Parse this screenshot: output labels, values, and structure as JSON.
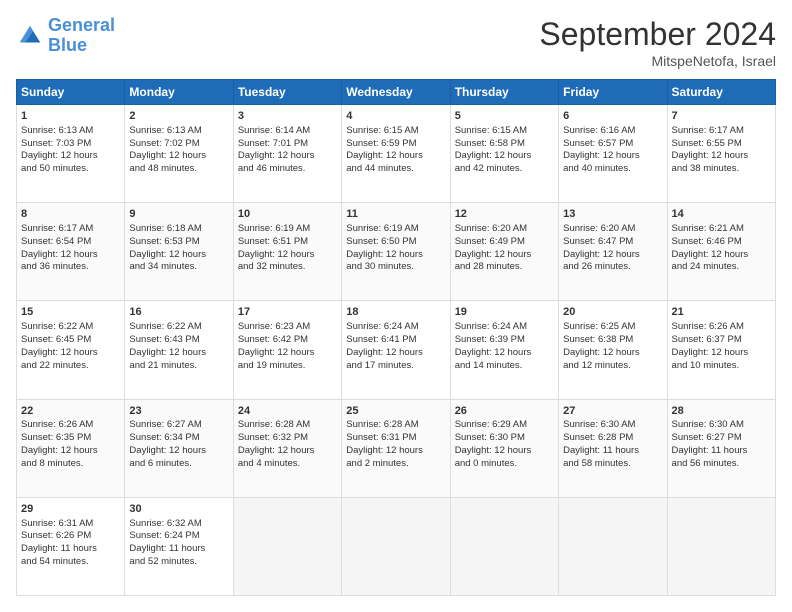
{
  "header": {
    "logo_line1": "General",
    "logo_line2": "Blue",
    "month": "September 2024",
    "location": "MitspeNetofa, Israel"
  },
  "weekdays": [
    "Sunday",
    "Monday",
    "Tuesday",
    "Wednesday",
    "Thursday",
    "Friday",
    "Saturday"
  ],
  "weeks": [
    [
      {
        "day": 1,
        "lines": [
          "Sunrise: 6:13 AM",
          "Sunset: 7:03 PM",
          "Daylight: 12 hours",
          "and 50 minutes."
        ]
      },
      {
        "day": 2,
        "lines": [
          "Sunrise: 6:13 AM",
          "Sunset: 7:02 PM",
          "Daylight: 12 hours",
          "and 48 minutes."
        ]
      },
      {
        "day": 3,
        "lines": [
          "Sunrise: 6:14 AM",
          "Sunset: 7:01 PM",
          "Daylight: 12 hours",
          "and 46 minutes."
        ]
      },
      {
        "day": 4,
        "lines": [
          "Sunrise: 6:15 AM",
          "Sunset: 6:59 PM",
          "Daylight: 12 hours",
          "and 44 minutes."
        ]
      },
      {
        "day": 5,
        "lines": [
          "Sunrise: 6:15 AM",
          "Sunset: 6:58 PM",
          "Daylight: 12 hours",
          "and 42 minutes."
        ]
      },
      {
        "day": 6,
        "lines": [
          "Sunrise: 6:16 AM",
          "Sunset: 6:57 PM",
          "Daylight: 12 hours",
          "and 40 minutes."
        ]
      },
      {
        "day": 7,
        "lines": [
          "Sunrise: 6:17 AM",
          "Sunset: 6:55 PM",
          "Daylight: 12 hours",
          "and 38 minutes."
        ]
      }
    ],
    [
      {
        "day": 8,
        "lines": [
          "Sunrise: 6:17 AM",
          "Sunset: 6:54 PM",
          "Daylight: 12 hours",
          "and 36 minutes."
        ]
      },
      {
        "day": 9,
        "lines": [
          "Sunrise: 6:18 AM",
          "Sunset: 6:53 PM",
          "Daylight: 12 hours",
          "and 34 minutes."
        ]
      },
      {
        "day": 10,
        "lines": [
          "Sunrise: 6:19 AM",
          "Sunset: 6:51 PM",
          "Daylight: 12 hours",
          "and 32 minutes."
        ]
      },
      {
        "day": 11,
        "lines": [
          "Sunrise: 6:19 AM",
          "Sunset: 6:50 PM",
          "Daylight: 12 hours",
          "and 30 minutes."
        ]
      },
      {
        "day": 12,
        "lines": [
          "Sunrise: 6:20 AM",
          "Sunset: 6:49 PM",
          "Daylight: 12 hours",
          "and 28 minutes."
        ]
      },
      {
        "day": 13,
        "lines": [
          "Sunrise: 6:20 AM",
          "Sunset: 6:47 PM",
          "Daylight: 12 hours",
          "and 26 minutes."
        ]
      },
      {
        "day": 14,
        "lines": [
          "Sunrise: 6:21 AM",
          "Sunset: 6:46 PM",
          "Daylight: 12 hours",
          "and 24 minutes."
        ]
      }
    ],
    [
      {
        "day": 15,
        "lines": [
          "Sunrise: 6:22 AM",
          "Sunset: 6:45 PM",
          "Daylight: 12 hours",
          "and 22 minutes."
        ]
      },
      {
        "day": 16,
        "lines": [
          "Sunrise: 6:22 AM",
          "Sunset: 6:43 PM",
          "Daylight: 12 hours",
          "and 21 minutes."
        ]
      },
      {
        "day": 17,
        "lines": [
          "Sunrise: 6:23 AM",
          "Sunset: 6:42 PM",
          "Daylight: 12 hours",
          "and 19 minutes."
        ]
      },
      {
        "day": 18,
        "lines": [
          "Sunrise: 6:24 AM",
          "Sunset: 6:41 PM",
          "Daylight: 12 hours",
          "and 17 minutes."
        ]
      },
      {
        "day": 19,
        "lines": [
          "Sunrise: 6:24 AM",
          "Sunset: 6:39 PM",
          "Daylight: 12 hours",
          "and 14 minutes."
        ]
      },
      {
        "day": 20,
        "lines": [
          "Sunrise: 6:25 AM",
          "Sunset: 6:38 PM",
          "Daylight: 12 hours",
          "and 12 minutes."
        ]
      },
      {
        "day": 21,
        "lines": [
          "Sunrise: 6:26 AM",
          "Sunset: 6:37 PM",
          "Daylight: 12 hours",
          "and 10 minutes."
        ]
      }
    ],
    [
      {
        "day": 22,
        "lines": [
          "Sunrise: 6:26 AM",
          "Sunset: 6:35 PM",
          "Daylight: 12 hours",
          "and 8 minutes."
        ]
      },
      {
        "day": 23,
        "lines": [
          "Sunrise: 6:27 AM",
          "Sunset: 6:34 PM",
          "Daylight: 12 hours",
          "and 6 minutes."
        ]
      },
      {
        "day": 24,
        "lines": [
          "Sunrise: 6:28 AM",
          "Sunset: 6:32 PM",
          "Daylight: 12 hours",
          "and 4 minutes."
        ]
      },
      {
        "day": 25,
        "lines": [
          "Sunrise: 6:28 AM",
          "Sunset: 6:31 PM",
          "Daylight: 12 hours",
          "and 2 minutes."
        ]
      },
      {
        "day": 26,
        "lines": [
          "Sunrise: 6:29 AM",
          "Sunset: 6:30 PM",
          "Daylight: 12 hours",
          "and 0 minutes."
        ]
      },
      {
        "day": 27,
        "lines": [
          "Sunrise: 6:30 AM",
          "Sunset: 6:28 PM",
          "Daylight: 11 hours",
          "and 58 minutes."
        ]
      },
      {
        "day": 28,
        "lines": [
          "Sunrise: 6:30 AM",
          "Sunset: 6:27 PM",
          "Daylight: 11 hours",
          "and 56 minutes."
        ]
      }
    ],
    [
      {
        "day": 29,
        "lines": [
          "Sunrise: 6:31 AM",
          "Sunset: 6:26 PM",
          "Daylight: 11 hours",
          "and 54 minutes."
        ]
      },
      {
        "day": 30,
        "lines": [
          "Sunrise: 6:32 AM",
          "Sunset: 6:24 PM",
          "Daylight: 11 hours",
          "and 52 minutes."
        ]
      },
      null,
      null,
      null,
      null,
      null
    ]
  ]
}
